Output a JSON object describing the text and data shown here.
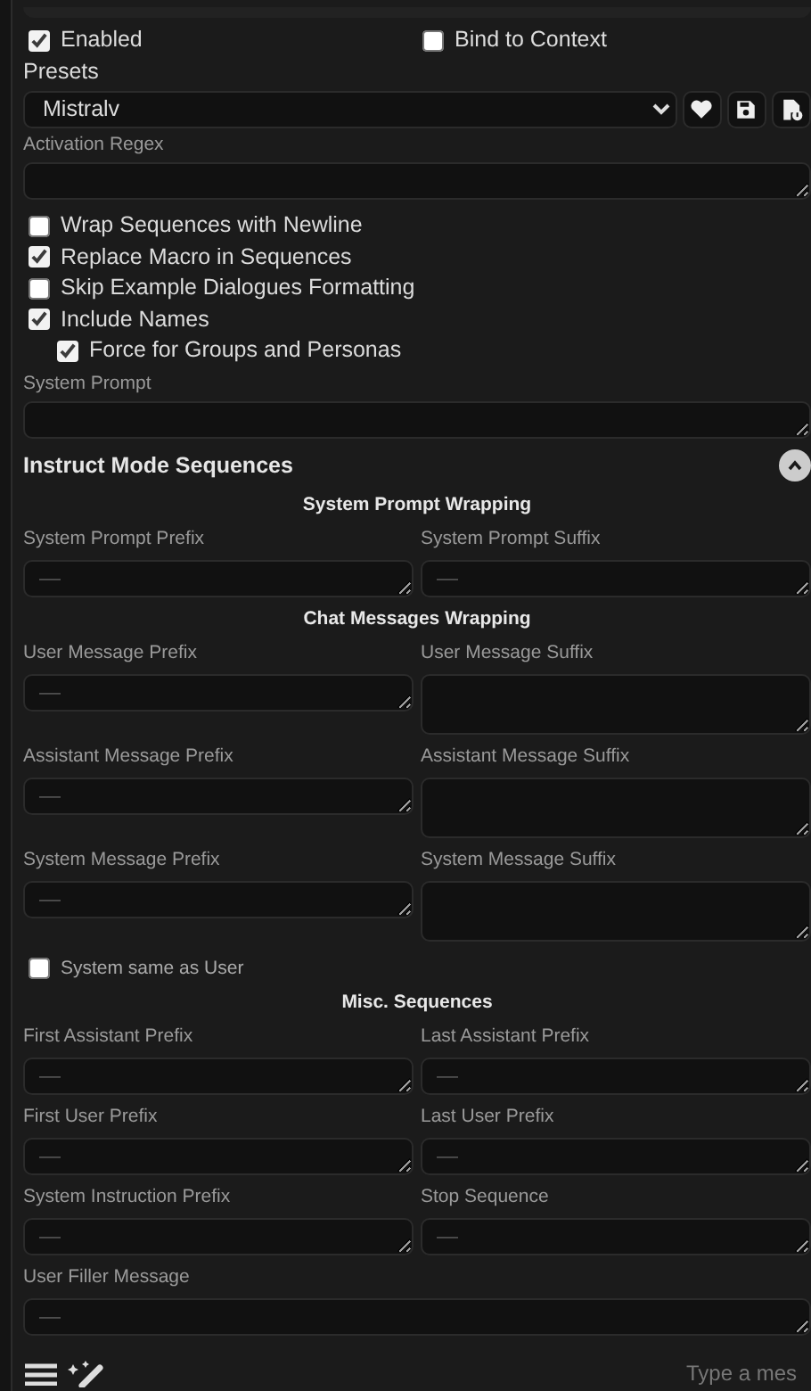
{
  "toggles": [
    {
      "label": "Enabled",
      "checked": true
    },
    {
      "label": "Bind to Context",
      "checked": false
    }
  ],
  "presets": {
    "label": "Presets",
    "value": "Mistralv"
  },
  "activation_regex": {
    "label": "Activation Regex"
  },
  "options": [
    {
      "label": "Wrap Sequences with Newline",
      "checked": false
    },
    {
      "label": "Replace Macro in Sequences",
      "checked": true
    },
    {
      "label": "Skip Example Dialogues Formatting",
      "checked": false
    },
    {
      "label": "Include Names",
      "checked": true,
      "children": [
        {
          "label": "Force for Groups and Personas",
          "checked": true
        }
      ]
    }
  ],
  "system_prompt": {
    "label": "System Prompt"
  },
  "sequences": {
    "title": "Instruct Mode Sequences",
    "expanded": true,
    "groups": [
      {
        "title": "System Prompt Wrapping",
        "fields": [
          {
            "label": "System Prompt Prefix",
            "placeholder": "—"
          },
          {
            "label": "System Prompt Suffix",
            "placeholder": "—"
          }
        ]
      },
      {
        "title": "Chat Messages Wrapping",
        "fields": [
          {
            "label": "User Message Prefix",
            "placeholder": "—"
          },
          {
            "label": "User Message Suffix"
          },
          {
            "label": "Assistant Message Prefix",
            "placeholder": "—"
          },
          {
            "label": "Assistant Message Suffix"
          },
          {
            "label": "System Message Prefix",
            "placeholder": "—"
          },
          {
            "label": "System Message Suffix"
          }
        ],
        "options": [
          {
            "label": "System same as User",
            "checked": false
          }
        ]
      },
      {
        "title": "Misc. Sequences",
        "fields": [
          {
            "label": "First Assistant Prefix",
            "placeholder": "—"
          },
          {
            "label": "Last Assistant Prefix",
            "placeholder": "—"
          },
          {
            "label": "First User Prefix",
            "placeholder": "—"
          },
          {
            "label": "Last User Prefix",
            "placeholder": "—"
          },
          {
            "label": "System Instruction Prefix",
            "placeholder": "—"
          },
          {
            "label": "Stop Sequence",
            "placeholder": "—"
          }
        ],
        "wide_fields": [
          {
            "label": "User Filler Message",
            "placeholder": "—"
          }
        ]
      }
    ]
  },
  "chat_input": {
    "placeholder": "Type a mes"
  }
}
